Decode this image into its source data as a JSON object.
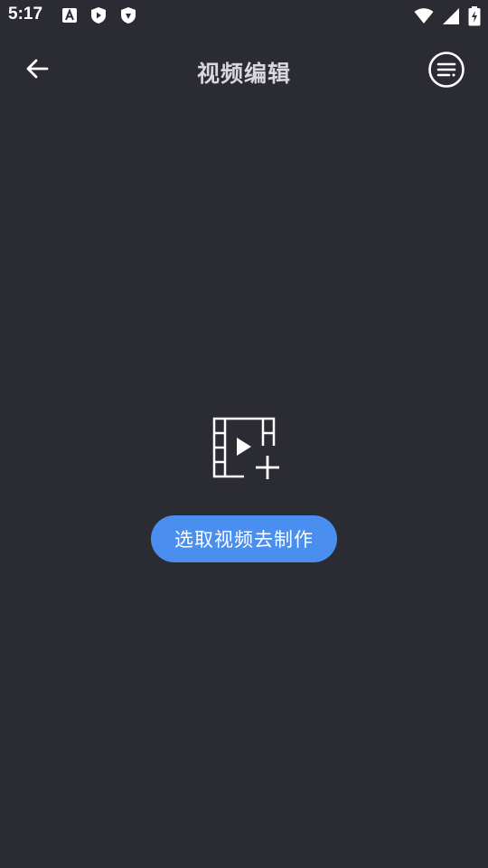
{
  "status_bar": {
    "time": "5:17",
    "left_icons": [
      "font-a-icon",
      "shield-play-icon",
      "shield-icon"
    ],
    "right_icons": [
      "wifi-icon",
      "cell-signal-icon",
      "battery-charging-icon"
    ]
  },
  "app_bar": {
    "title": "视频编辑",
    "back_icon": "arrow-left-icon",
    "menu_icon": "menu-circle-icon"
  },
  "empty_state": {
    "icon": "video-add-icon",
    "button_label": "选取视频去制作"
  },
  "colors": {
    "background": "#2a2b33",
    "accent": "#4a8ef0",
    "title": "#d8d8dc"
  }
}
